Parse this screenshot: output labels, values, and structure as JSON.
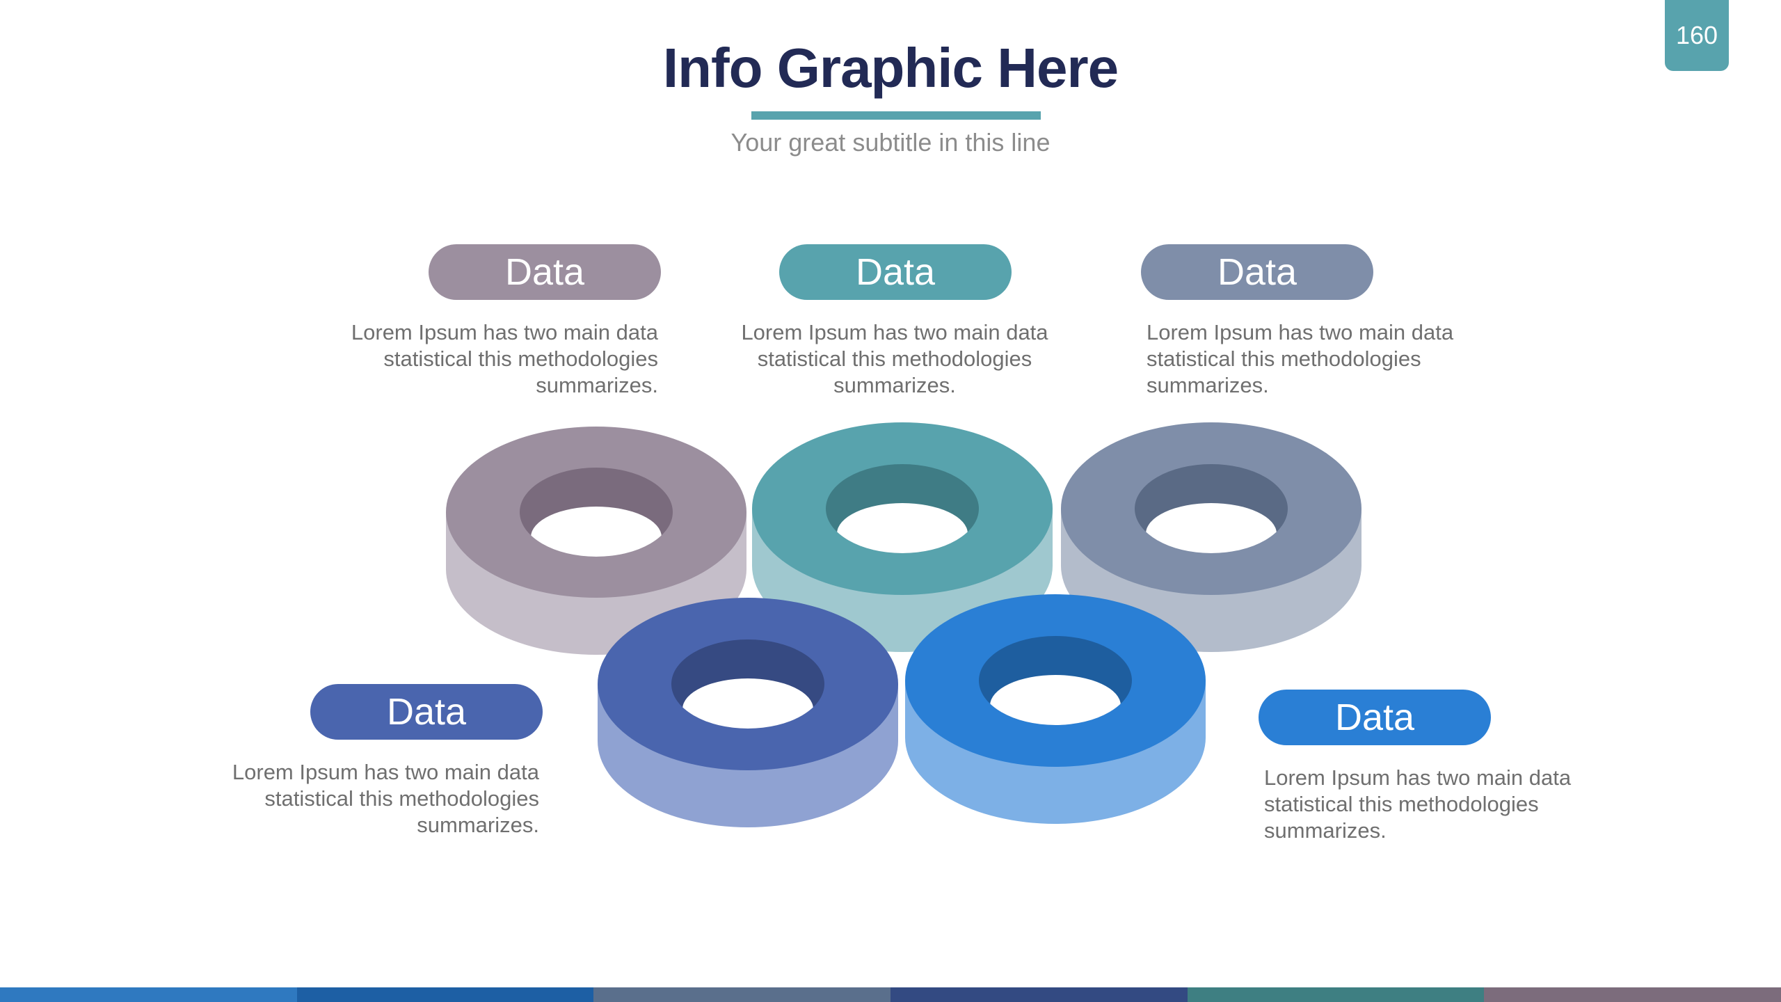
{
  "page_number": "160",
  "title": "Info Graphic Here",
  "subtitle": "Your great subtitle in this line",
  "colors": {
    "title": "#222a55",
    "accent": "#58a3ad",
    "body_text": "#6f6f6f"
  },
  "items": [
    {
      "label": "Data",
      "color": "#9c8f9f",
      "side": "#c5bec9",
      "hole": "#7a6b7d",
      "desc": [
        "Lorem Ipsum has two main data",
        "statistical this methodologies",
        "summarizes."
      ]
    },
    {
      "label": "Data",
      "color": "#58a3ad",
      "side": "#9fc8cf",
      "hole": "#3f7c85",
      "desc": [
        "Lorem Ipsum has two main data",
        "statistical this methodologies",
        "summarizes."
      ]
    },
    {
      "label": "Data",
      "color": "#7f8ea9",
      "side": "#b3bccb",
      "hole": "#5a6a85",
      "desc": [
        "Lorem Ipsum has two main data",
        "statistical this methodologies",
        "summarizes."
      ]
    },
    {
      "label": "Data",
      "color": "#4a65ae",
      "side": "#8fa2d2",
      "hole": "#364a82",
      "desc": [
        "Lorem Ipsum has two main data",
        "statistical this methodologies",
        "summarizes."
      ]
    },
    {
      "label": "Data",
      "color": "#2a7fd5",
      "side": "#7db0e6",
      "hole": "#1e5e9f",
      "desc": [
        "Lorem Ipsum has two main data",
        "statistical this methodologies",
        "summarizes."
      ]
    }
  ],
  "bottom_strip_colors": [
    "#2f79c0",
    "#1d5fa4",
    "#5a6f8c",
    "#334a82",
    "#3e7f82",
    "#7c6c7c"
  ]
}
